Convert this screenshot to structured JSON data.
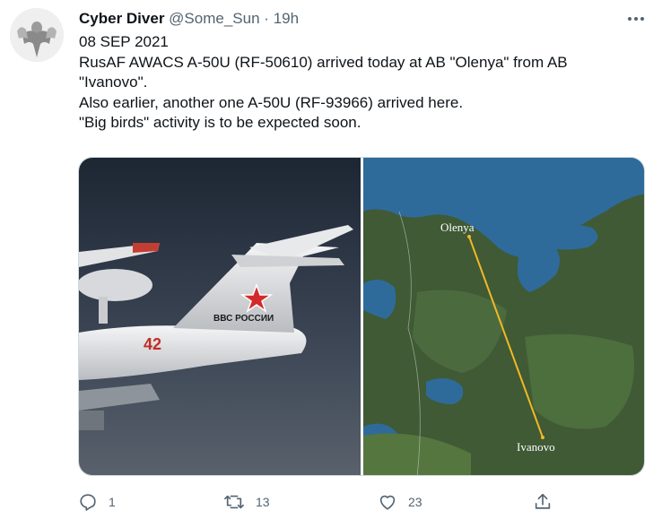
{
  "tweet": {
    "display_name": "Cyber Diver",
    "handle": "@Some_Sun",
    "separator": "·",
    "time": "19h",
    "lines": [
      "08 SEP 2021",
      "RusAF AWACS A-50U (RF-50610) arrived today at AB \"Olenya\" from AB",
      "\"Ivanovo\".",
      "Also earlier, another one A-50U (RF-93966) arrived here.",
      "\"Big birds\" activity is to be expected soon."
    ]
  },
  "media": {
    "left_photo": {
      "tail_text": "ВВС РОССИИ",
      "number": "42"
    },
    "right_map": {
      "label_start": "Olenya",
      "label_end": "Ivanovo",
      "route_color": "#f2b824"
    }
  },
  "actions": {
    "reply_count": "1",
    "retweet_count": "13",
    "like_count": "23"
  },
  "icons": {
    "more": "more-icon",
    "reply": "reply-icon",
    "retweet": "retweet-icon",
    "like": "like-icon",
    "share": "share-icon"
  },
  "colors": {
    "text": "#0f1419",
    "secondary": "#536471",
    "star": "#d42a2a"
  }
}
